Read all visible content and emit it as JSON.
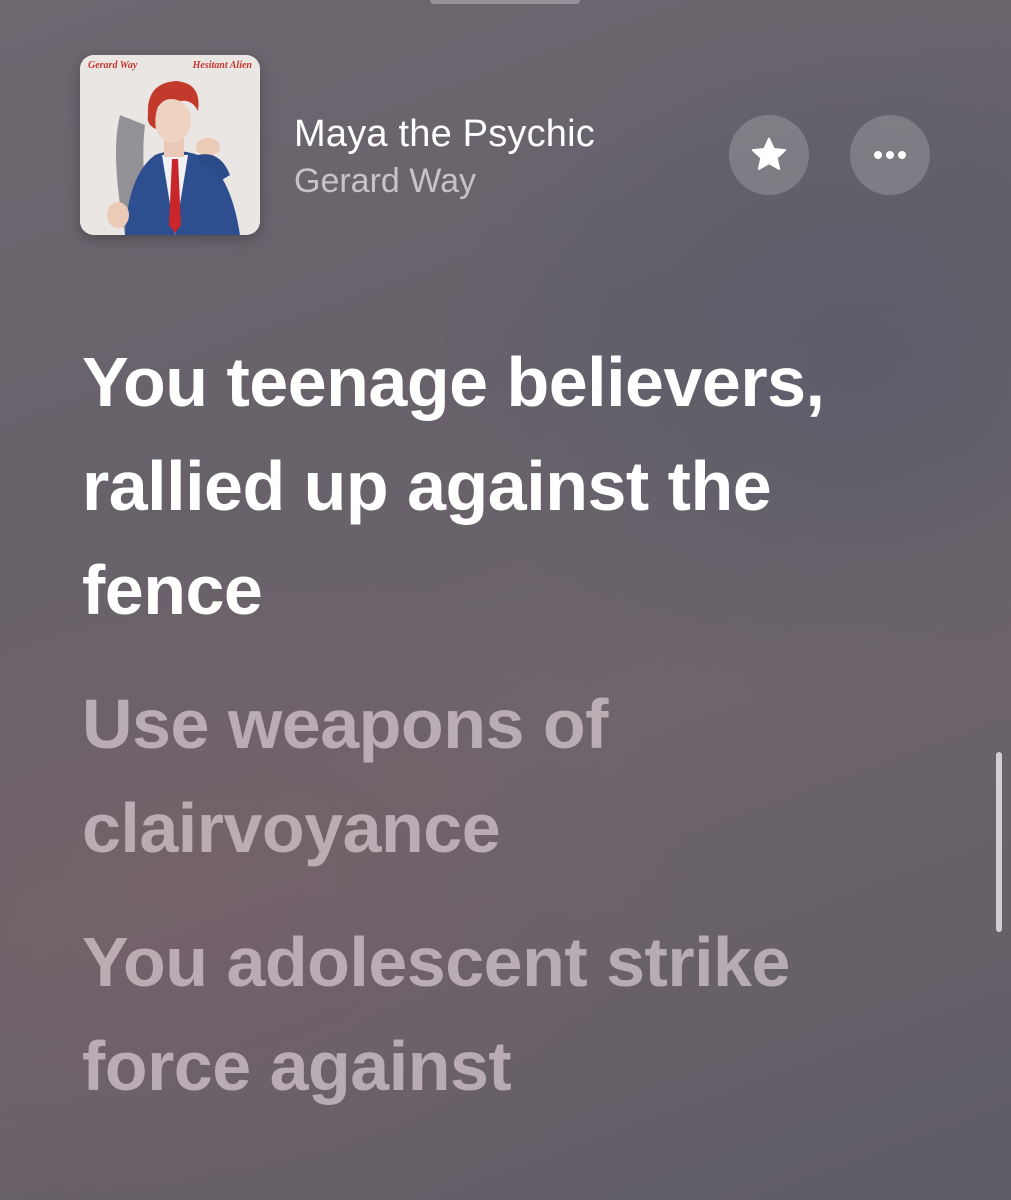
{
  "now_playing": {
    "title": "Maya the Psychic",
    "artist": "Gerard Way",
    "artwork": {
      "artist_text": "Gerard Way",
      "album_text": "Hesitant Alien"
    }
  },
  "controls": {
    "favorite_icon": "star-icon",
    "more_icon": "ellipsis-icon"
  },
  "lyrics": [
    {
      "text": "You teenage believers, rallied up against the fence",
      "state": "active"
    },
    {
      "text": "Use weapons of clairvoyance",
      "state": "upcoming"
    },
    {
      "text": "You adolescent strike force against",
      "state": "upcoming"
    }
  ],
  "colors": {
    "active_lyric": "#ffffff",
    "upcoming_lyric": "#d9cbd3",
    "artwork_title_red": "#c8362f"
  }
}
